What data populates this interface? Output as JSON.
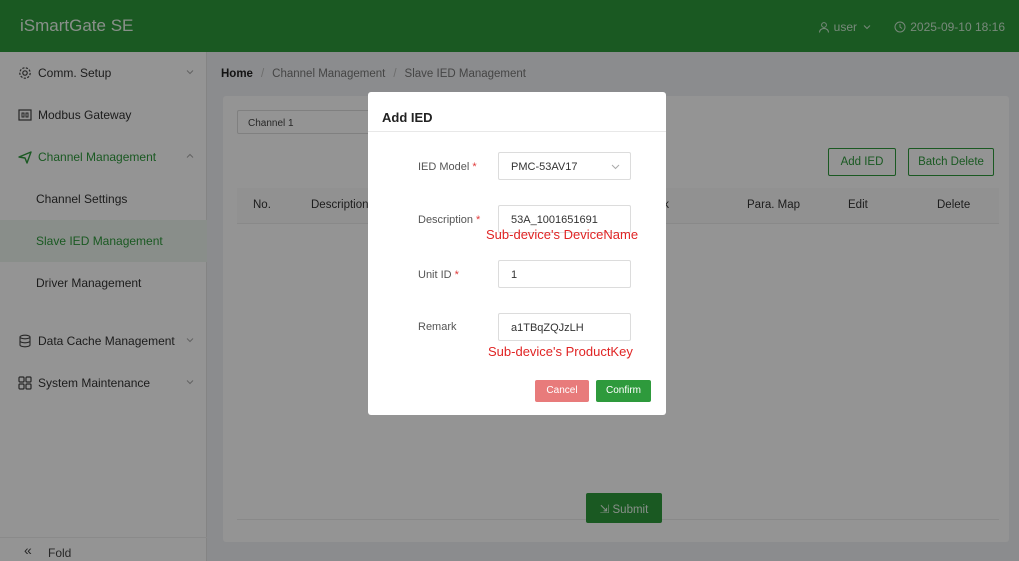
{
  "header": {
    "brand": "iSmartGate SE",
    "user": "user",
    "datetime": "2025-09-10  18:16"
  },
  "sidebar": {
    "items": [
      {
        "label": "Comm. Setup"
      },
      {
        "label": "Modbus Gateway"
      },
      {
        "label": "Channel Management"
      },
      {
        "label": "Channel Settings"
      },
      {
        "label": "Slave IED Management"
      },
      {
        "label": "Driver Management"
      },
      {
        "label": "Data Cache Management"
      },
      {
        "label": "System Maintenance"
      }
    ],
    "fold_label": "Fold"
  },
  "breadcrumb": {
    "home": "Home",
    "level1": "Channel Management",
    "level2": "Slave IED Management"
  },
  "main": {
    "channel_tab": "Channel 1",
    "add_ied_label": "Add IED",
    "batch_delete_label": "Batch Delete",
    "columns": [
      "No.",
      "Description",
      "ark",
      "Para. Map",
      "Edit",
      "Delete"
    ],
    "submit_label": "Submit"
  },
  "modal": {
    "title": "Add IED",
    "fields": {
      "ied_model": {
        "label": "IED Model",
        "value": "PMC-53AV17"
      },
      "description": {
        "label": "Description",
        "value": "53A_1001651691"
      },
      "unit_id": {
        "label": "Unit ID",
        "value": "1"
      },
      "remark": {
        "label": "Remark",
        "value": "a1TBqZQJzLH"
      }
    },
    "required_mark": "*",
    "annotation_description": "Sub-device's DeviceName",
    "annotation_remark": "Sub-device's ProductKey",
    "cancel_label": "Cancel",
    "confirm_label": "Confirm"
  },
  "colors": {
    "brand_green": "#2e9a3c",
    "cancel_red": "#e87b7b",
    "annotation_red": "#e02424"
  }
}
